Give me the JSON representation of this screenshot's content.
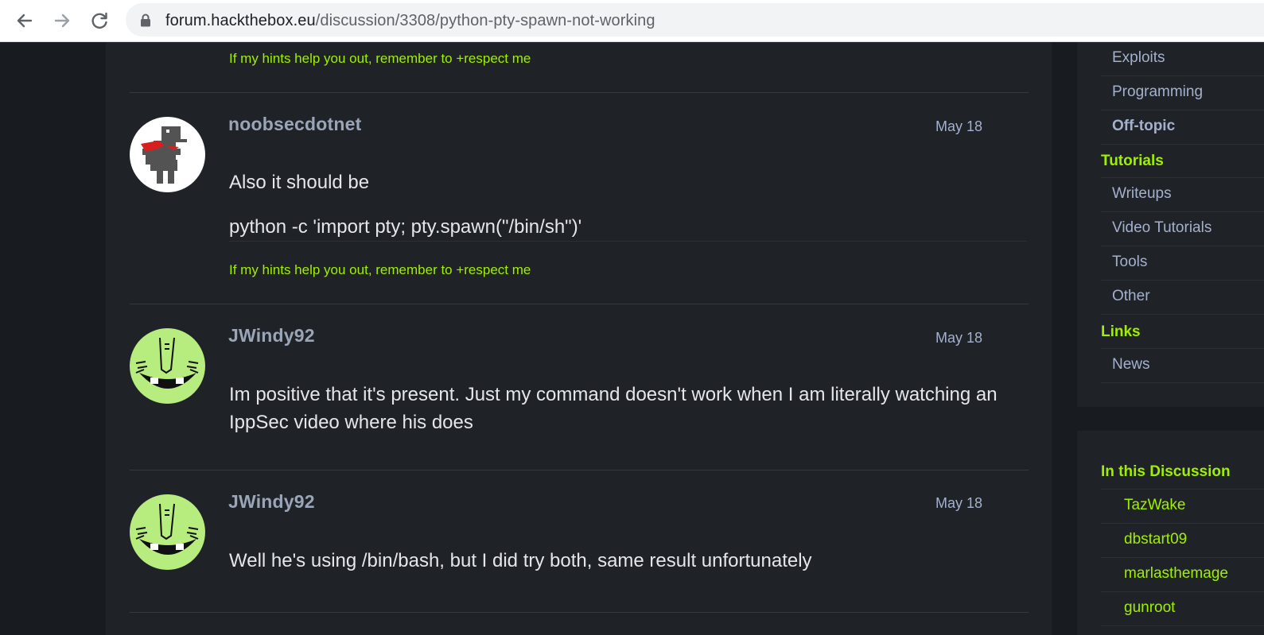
{
  "browser": {
    "url_host": "forum.hackthebox.eu",
    "url_path": "/discussion/3308/python-pty-spawn-not-working"
  },
  "posts": [
    {
      "signature": "If my hints help you out, remember to +respect me"
    },
    {
      "author": "noobsecdotnet",
      "date": "May 18",
      "body": "Also it should be",
      "code": "python -c 'import pty; pty.spawn(\"/bin/sh\")'",
      "signature": "If my hints help you out, remember to +respect me"
    },
    {
      "author": "JWindy92",
      "date": "May 18",
      "body": "Im positive that it's present. Just my command doesn't work when I am literally watching an IppSec video where his does"
    },
    {
      "author": "JWindy92",
      "date": "May 18",
      "body": "Well he's using /bin/bash, but I did try both, same result unfortunately"
    }
  ],
  "sidebar": {
    "categories": [
      {
        "label": "Exploits"
      },
      {
        "label": "Programming"
      },
      {
        "label": "Off-topic"
      }
    ],
    "tutorials_heading": "Tutorials",
    "tutorials": [
      {
        "label": "Writeups"
      },
      {
        "label": "Video Tutorials"
      },
      {
        "label": "Tools"
      },
      {
        "label": "Other"
      }
    ],
    "links_heading": "Links",
    "links": [
      {
        "label": "News"
      }
    ],
    "discussion_heading": "In this Discussion",
    "participants": [
      {
        "name": "TazWake"
      },
      {
        "name": "dbstart09"
      },
      {
        "name": "marlasthemage"
      },
      {
        "name": "gunroot"
      }
    ]
  },
  "colors": {
    "accent": "#9fef00",
    "background": "#1f2227",
    "text": "#e4e6eb"
  }
}
